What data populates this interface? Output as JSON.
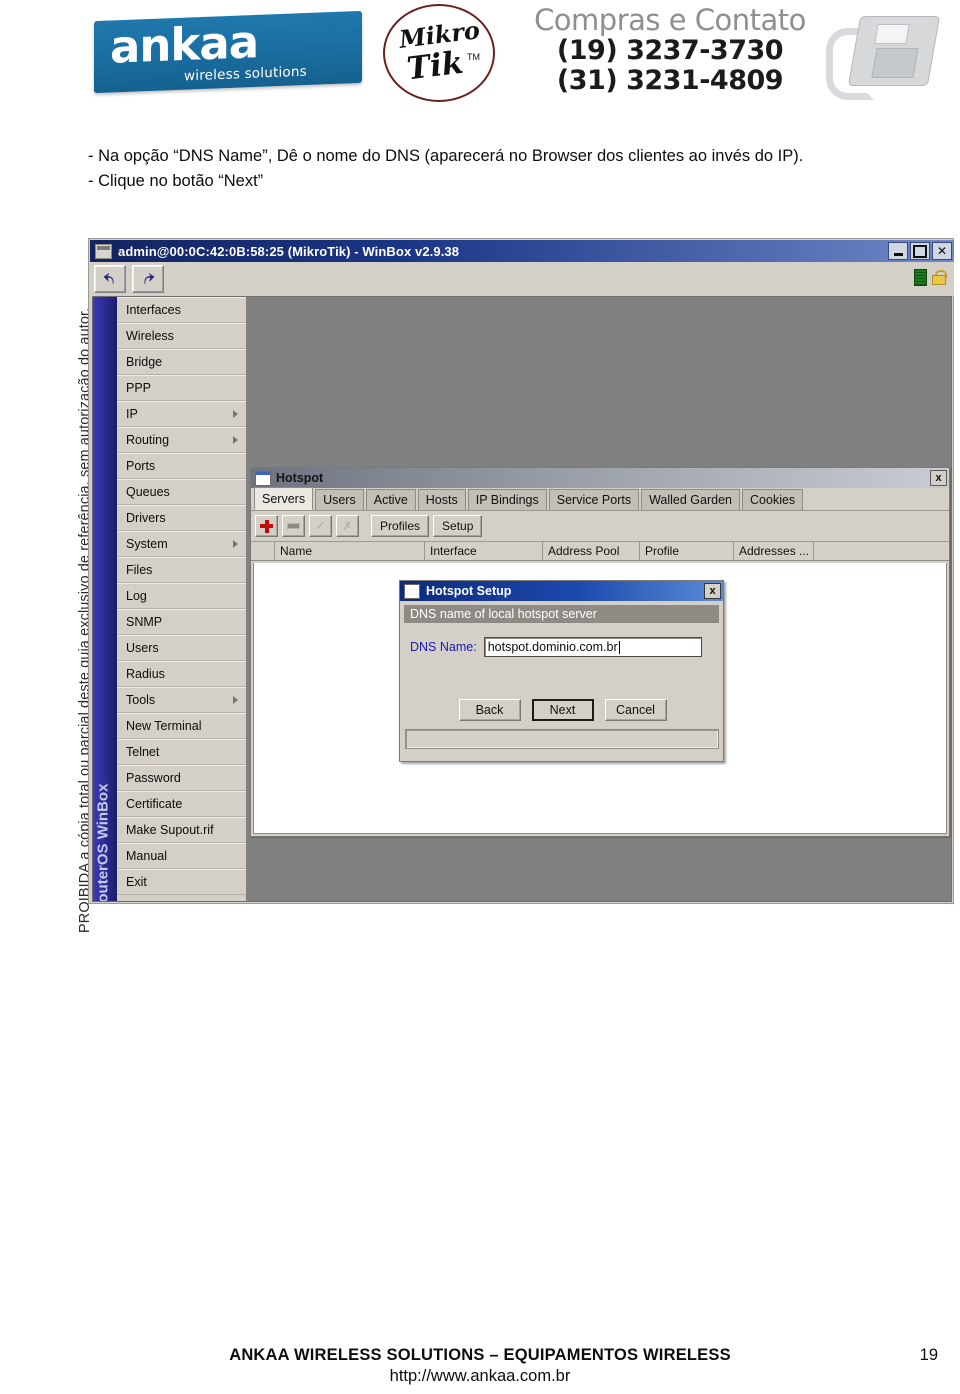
{
  "banner": {
    "ankaa": {
      "word": "ankaa",
      "tagline": "wireless solutions"
    },
    "mikrotik": {
      "line1": "Mikro",
      "line2": "Tik",
      "tm": "TM"
    },
    "contact": {
      "title": "Compras e Contato",
      "phone1": "(19) 3237-3730",
      "phone2": "(31) 3231-4809"
    }
  },
  "watermark": {
    "text": "PROIBIDA a cópia total ou parcial deste guia exclusivo de referência, sem autorização do autor."
  },
  "instructions": {
    "line1": "- Na opção “DNS Name”, Dê o nome do DNS (aparecerá no Browser dos clientes ao invés do IP).",
    "line2": "- Clique no botão “Next”"
  },
  "winbox": {
    "title": "admin@00:0C:42:0B:58:25 (MikroTik) - WinBox v2.9.38",
    "sysbuttons": {
      "minimize": "_",
      "maximize": "□",
      "close": "✕"
    },
    "toolbar": {
      "undo_label": "undo-arrow",
      "redo_label": "redo-arrow"
    },
    "status_icons": {
      "memory": "green-bars-icon",
      "secure": "lock-icon"
    },
    "spine_label": "RouterOS WinBox",
    "menu": [
      {
        "label": "Interfaces",
        "submenu": false
      },
      {
        "label": "Wireless",
        "submenu": false
      },
      {
        "label": "Bridge",
        "submenu": false
      },
      {
        "label": "PPP",
        "submenu": false
      },
      {
        "label": "IP",
        "submenu": true
      },
      {
        "label": "Routing",
        "submenu": true
      },
      {
        "label": "Ports",
        "submenu": false
      },
      {
        "label": "Queues",
        "submenu": false
      },
      {
        "label": "Drivers",
        "submenu": false
      },
      {
        "label": "System",
        "submenu": true
      },
      {
        "label": "Files",
        "submenu": false
      },
      {
        "label": "Log",
        "submenu": false
      },
      {
        "label": "SNMP",
        "submenu": false
      },
      {
        "label": "Users",
        "submenu": false
      },
      {
        "label": "Radius",
        "submenu": false
      },
      {
        "label": "Tools",
        "submenu": true
      },
      {
        "label": "New Terminal",
        "submenu": false
      },
      {
        "label": "Telnet",
        "submenu": false
      },
      {
        "label": "Password",
        "submenu": false
      },
      {
        "label": "Certificate",
        "submenu": false
      },
      {
        "label": "Make Supout.rif",
        "submenu": false
      },
      {
        "label": "Manual",
        "submenu": false
      },
      {
        "label": "Exit",
        "submenu": false
      }
    ]
  },
  "hotspot": {
    "title": "Hotspot",
    "close_label": "x",
    "tabs": [
      {
        "label": "Servers",
        "active": true
      },
      {
        "label": "Users",
        "active": false
      },
      {
        "label": "Active",
        "active": false
      },
      {
        "label": "Hosts",
        "active": false
      },
      {
        "label": "IP Bindings",
        "active": false
      },
      {
        "label": "Service Ports",
        "active": false
      },
      {
        "label": "Walled Garden",
        "active": false
      },
      {
        "label": "Cookies",
        "active": false
      }
    ],
    "toolbar": {
      "add": "+",
      "remove": "–",
      "enable": "✓",
      "disable": "✗",
      "profiles": "Profiles",
      "setup": "Setup"
    },
    "columns": [
      "",
      "Name",
      "Interface",
      "Address Pool",
      "Profile",
      "Addresses ...",
      ""
    ],
    "rows": []
  },
  "setup_dialog": {
    "title": "Hotspot Setup",
    "close_label": "x",
    "subheader": "DNS name of local hotspot server",
    "field_label": "DNS Name:",
    "field_value": "hotspot.dominio.com.br",
    "field_placeholder": "",
    "buttons": {
      "back": "Back",
      "next": "Next",
      "cancel": "Cancel"
    },
    "status": ""
  },
  "footer": {
    "line1": "ANKAA WIRELESS SOLUTIONS – EQUIPAMENTOS WIRELESS",
    "line2": "http://www.ankaa.com.br",
    "page": "19"
  },
  "colors": {
    "winbox_titlebar": "#16266b",
    "menu_spine": "#2a2a8f",
    "dialog_titlebar": "#1d49ad",
    "chrome_face": "#d4d0c8",
    "desktop": "#808080",
    "accent_red": "#c00c0c",
    "label_blue": "#1a1ab5"
  }
}
